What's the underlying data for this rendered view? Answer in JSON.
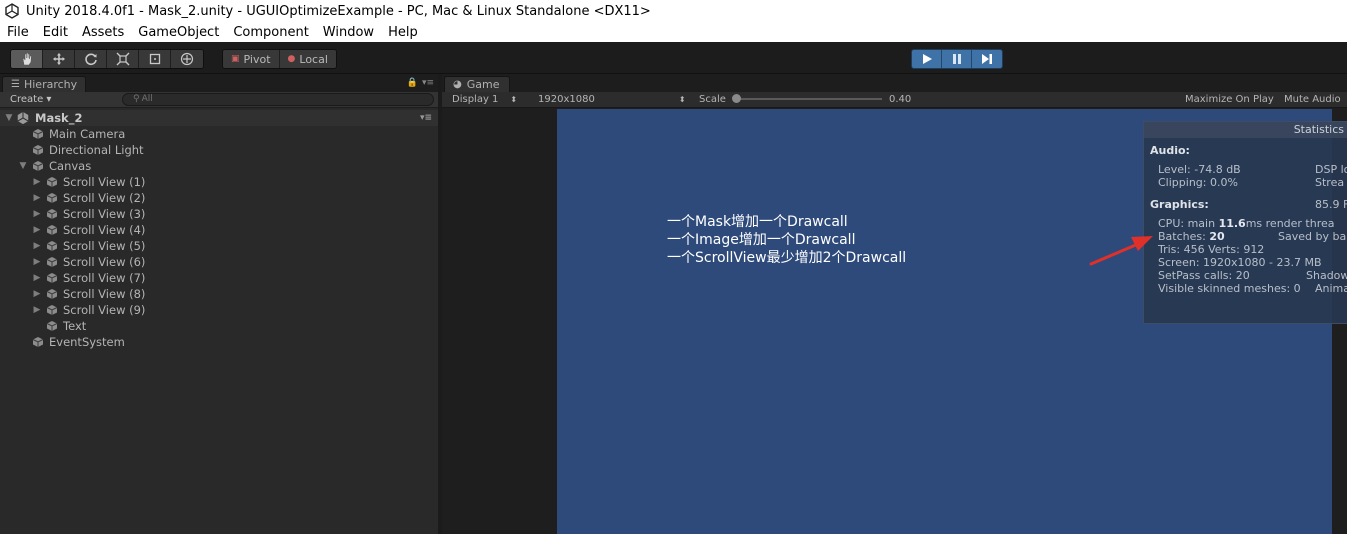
{
  "window": {
    "title": "Unity 2018.4.0f1 - Mask_2.unity - UGUIOptimizeExample - PC, Mac & Linux Standalone <DX11>"
  },
  "menu": [
    "File",
    "Edit",
    "Assets",
    "GameObject",
    "Component",
    "Window",
    "Help"
  ],
  "toolbar": {
    "tools": [
      "hand-tool-icon",
      "move-tool-icon",
      "rotate-tool-icon",
      "scale-tool-icon",
      "rect-tool-icon",
      "transform-tool-icon"
    ],
    "pivot_label": "Pivot",
    "local_label": "Local",
    "play_colors": {
      "active": "#3f73a8"
    }
  },
  "hierarchy": {
    "tab_label": "Hierarchy",
    "create_label": "Create",
    "search_placeholder": "All",
    "scene": "Mask_2",
    "items": [
      {
        "label": "Main Camera",
        "depth": 1,
        "arrow": false
      },
      {
        "label": "Directional Light",
        "depth": 1,
        "arrow": false
      },
      {
        "label": "Canvas",
        "depth": 1,
        "arrow": "open"
      },
      {
        "label": "Scroll View (1)",
        "depth": 2,
        "arrow": "closed"
      },
      {
        "label": "Scroll View (2)",
        "depth": 2,
        "arrow": "closed"
      },
      {
        "label": "Scroll View (3)",
        "depth": 2,
        "arrow": "closed"
      },
      {
        "label": "Scroll View (4)",
        "depth": 2,
        "arrow": "closed"
      },
      {
        "label": "Scroll View (5)",
        "depth": 2,
        "arrow": "closed"
      },
      {
        "label": "Scroll View (6)",
        "depth": 2,
        "arrow": "closed"
      },
      {
        "label": "Scroll View (7)",
        "depth": 2,
        "arrow": "closed"
      },
      {
        "label": "Scroll View (8)",
        "depth": 2,
        "arrow": "closed"
      },
      {
        "label": "Scroll View (9)",
        "depth": 2,
        "arrow": "closed"
      },
      {
        "label": "Text",
        "depth": 2,
        "arrow": false
      },
      {
        "label": "EventSystem",
        "depth": 1,
        "arrow": false
      }
    ]
  },
  "game": {
    "tab_label": "Game",
    "display": "Display 1",
    "resolution": "1920x1080",
    "scale_label": "Scale",
    "scale_value": "0.40",
    "maximize_label": "Maximize On Play",
    "mute_label": "Mute Audio",
    "background": "#2d4a7b",
    "notes": [
      "一个Mask增加一个Drawcall",
      "一个Image增加一个Drawcall",
      "一个ScrollView最少增加2个Drawcall"
    ]
  },
  "statistics": {
    "title": "Statistics",
    "audio_header": "Audio:",
    "level": "Level: -74.8 dB",
    "clipping": "Clipping: 0.0%",
    "dsp": "DSP lo",
    "stream": "Strea",
    "graphics_header": "Graphics:",
    "fps": "85.9 F",
    "cpu_prefix": "CPU: main ",
    "cpu_value": "11.6",
    "cpu_suffix": "ms  render threa",
    "batches_prefix": "Batches: ",
    "batches_value": "20",
    "saved": "Saved by ba",
    "tris": "Tris: 456  Verts: 912",
    "screen": "Screen: 1920x1080 - 23.7 MB",
    "setpass": "SetPass calls: 20",
    "shadow": "Shadow cast",
    "skinned": "Visible skinned meshes: 0",
    "anim": "Anima"
  },
  "annotation": {
    "arrow_color": "#e0302a"
  }
}
